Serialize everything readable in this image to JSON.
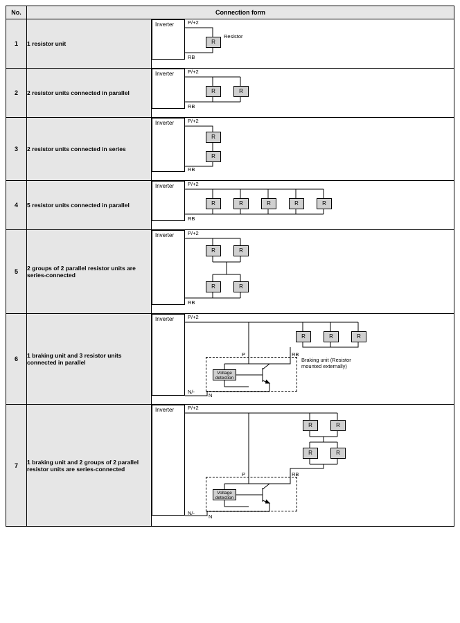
{
  "table": {
    "headers": {
      "no": "No.",
      "form": "Connection form"
    },
    "rows": [
      {
        "no": "1",
        "desc": "1 resistor unit"
      },
      {
        "no": "2",
        "desc": "2 resistor units connected in parallel"
      },
      {
        "no": "3",
        "desc": "2 resistor units connected in series"
      },
      {
        "no": "4",
        "desc": "5 resistor units connected in parallel"
      },
      {
        "no": "5",
        "desc": "2 groups of 2 parallel resistor units are series-connected"
      },
      {
        "no": "6",
        "desc": "1 braking unit and 3 resistor units connected in parallel"
      },
      {
        "no": "7",
        "desc": "1 braking unit and 2 groups of 2 parallel resistor units are series-connected"
      }
    ]
  },
  "labels": {
    "inverter": "Inverter",
    "R": "R",
    "resistor": "Resistor",
    "Pplus2": "P/+2",
    "RB": "RB",
    "P": "P",
    "N": "N",
    "Nminus": "N/-",
    "voltage_detection": "Voltage detection",
    "braking_unit_note": "Braking unit (Resistor mounted externally)"
  }
}
